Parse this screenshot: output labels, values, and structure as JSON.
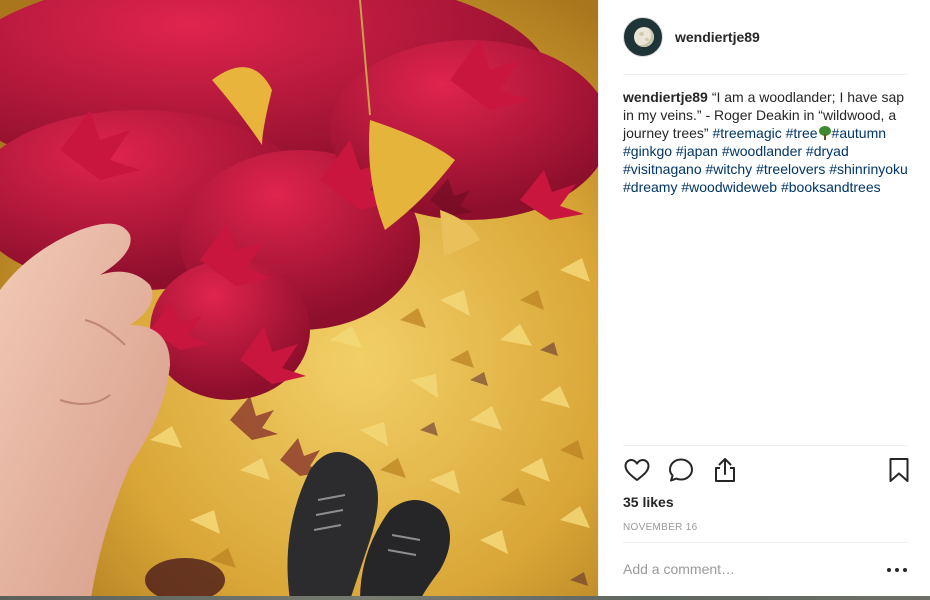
{
  "post": {
    "username": "wendiertje89",
    "caption": {
      "username": "wendiertje89",
      "text": "“I am a woodlander; I have sap in my veins.” - Roger Deakin in “wildwood, a journey trees”",
      "hashtags_before_emoji": "#treemagic #tree",
      "hashtags_after_emoji": "#autumn #ginkgo #japan #woodlander #dryad #visitnagano #witchy #treelovers #shinrinyoku #dreamy #woodwideweb #booksandtrees"
    },
    "likes": "35 likes",
    "date": "NOVEMBER 16",
    "comment": {
      "placeholder": "Add a comment…",
      "value": ""
    }
  },
  "icons": {
    "avatar": "moon-avatar",
    "like": "heart-icon",
    "comment": "speech-bubble-icon",
    "share": "share-upload-icon",
    "save": "bookmark-icon",
    "more": "more-options-icon",
    "emoji": "deciduous-tree-emoji"
  },
  "colors": {
    "text": "#262626",
    "hashtag": "#003569",
    "muted": "#999999",
    "divider": "#efefef"
  }
}
